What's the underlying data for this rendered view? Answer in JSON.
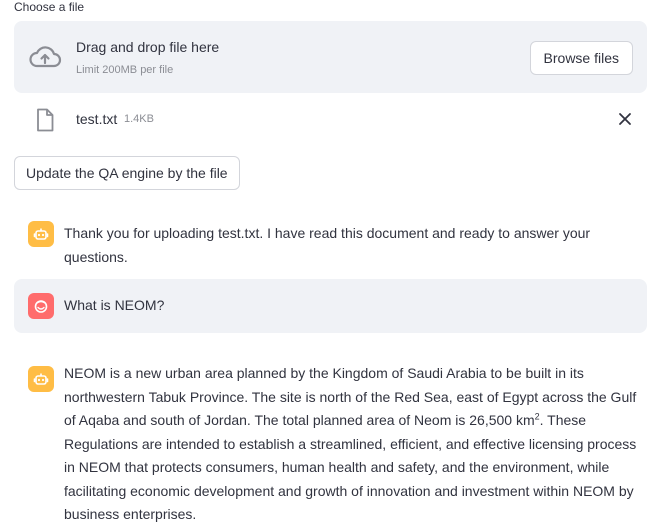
{
  "uploader": {
    "label": "Choose a file",
    "drop_title": "Drag and drop file here",
    "limit_text": "Limit 200MB per file",
    "browse_label": "Browse files",
    "upload_icon": "cloud-upload-icon"
  },
  "file": {
    "name": "test.txt",
    "size": "1.4KB",
    "icon": "file-icon",
    "remove_icon": "close-icon"
  },
  "update_button_label": "Update the QA engine by the file",
  "messages": [
    {
      "role": "assistant",
      "avatar_icon": "robot-icon",
      "text": "Thank you for uploading test.txt. I have read this document and ready to answer your questions."
    },
    {
      "role": "user",
      "avatar_icon": "user-face-icon",
      "text": "What is NEOM?"
    },
    {
      "role": "assistant",
      "avatar_icon": "robot-icon",
      "text_before_sup": "NEOM is a new urban area planned by the Kingdom of Saudi Arabia to be built in its northwestern Tabuk Province. The site is north of the Red Sea, east of Egypt across the Gulf of Aqaba and south of Jordan. The total planned area of Neom is 26,500 km",
      "sup": "2",
      "text_after_sup": ". These Regulations are intended to establish a streamlined, efficient, and effective licensing process in NEOM that protects consumers, human health and safety, and the environment, while facilitating economic development and growth of innovation and investment within NEOM by business enterprises."
    }
  ],
  "colors": {
    "panel_bg": "#f0f2f6",
    "assistant_avatar": "#ffbd45",
    "user_avatar": "#ff6c6c"
  }
}
